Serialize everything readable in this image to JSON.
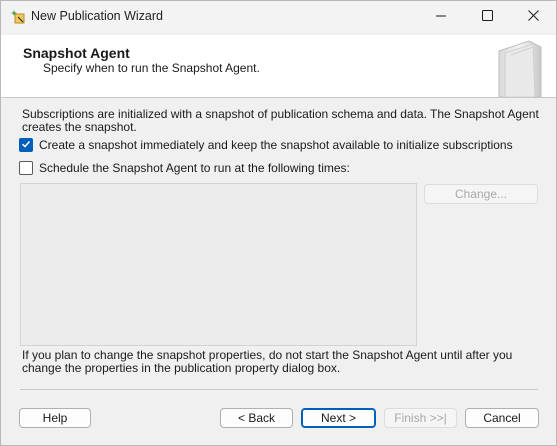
{
  "window": {
    "title": "New Publication Wizard"
  },
  "header": {
    "title": "Snapshot Agent",
    "subtitle": "Specify when to run the Snapshot Agent."
  },
  "body": {
    "description": "Subscriptions are initialized with a snapshot of publication schema and data. The Snapshot Agent creates the snapshot.",
    "options": [
      {
        "label": "Create a snapshot immediately and keep the snapshot available to initialize subscriptions",
        "checked": true
      },
      {
        "label": "Schedule the Snapshot Agent to run at the following times:",
        "checked": false
      }
    ],
    "change_label": "Change...",
    "note": "If you plan to change the snapshot properties, do not start the Snapshot Agent until after you change the properties in the publication property dialog box."
  },
  "footer": {
    "help_label": "Help",
    "back_label": "< Back",
    "next_label": "Next >",
    "finish_label": "Finish >>|",
    "cancel_label": "Cancel"
  },
  "icons": {
    "app": "wizard-sparkle-icon",
    "minimize": "minimize-icon",
    "maximize": "maximize-icon",
    "close": "close-icon",
    "header_art": "book-icon",
    "check": "checkmark-icon"
  },
  "colors": {
    "accent": "#005fb8",
    "header_bg": "#ffffff",
    "dialog_bg": "#f0f0f0"
  }
}
